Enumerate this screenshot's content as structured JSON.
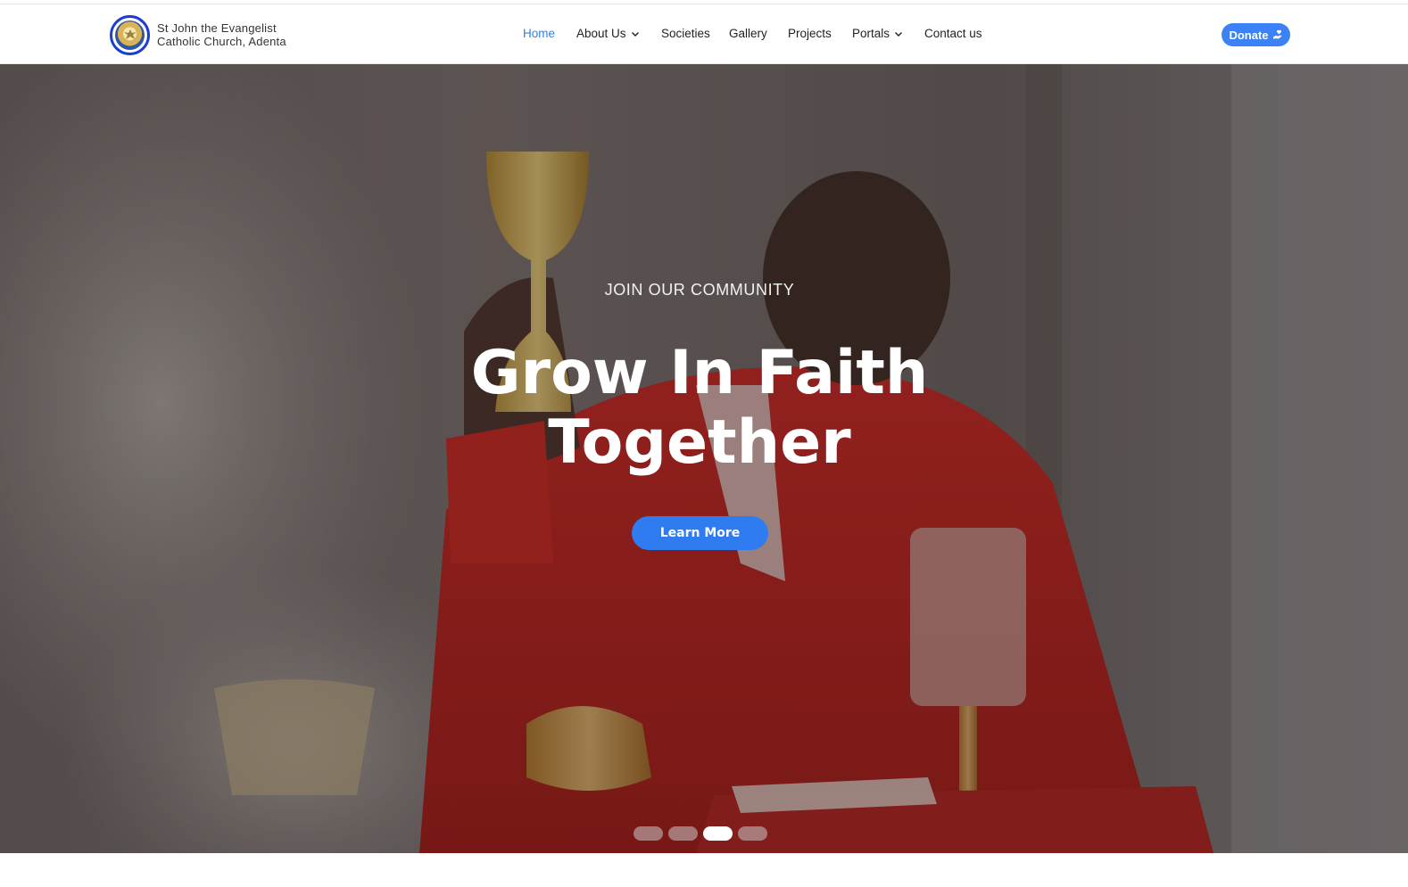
{
  "brand": {
    "line1": "St John the Evangelist",
    "line2": "Catholic Church, Adenta"
  },
  "nav": {
    "items": [
      {
        "label": "Home",
        "active": true,
        "dropdown": false
      },
      {
        "label": "About Us",
        "active": false,
        "dropdown": true
      },
      {
        "label": "Societies",
        "active": false,
        "dropdown": false
      },
      {
        "label": "Gallery",
        "active": false,
        "dropdown": false
      },
      {
        "label": "Projects",
        "active": false,
        "dropdown": false
      },
      {
        "label": "Portals",
        "active": false,
        "dropdown": true
      },
      {
        "label": "Contact us",
        "active": false,
        "dropdown": false
      }
    ]
  },
  "donate": {
    "label": "Donate",
    "icon": "hand-heart-icon"
  },
  "hero": {
    "eyebrow": "JOIN OUR COMMUNITY",
    "title_line1": "Grow In Faith",
    "title_line2": "Together",
    "cta_label": "Learn More",
    "slides_total": 4,
    "active_slide": 3
  },
  "colors": {
    "accent": "#3b82f6",
    "active_nav": "#2d7ff0",
    "logo_ring": "#1a3fcf"
  }
}
